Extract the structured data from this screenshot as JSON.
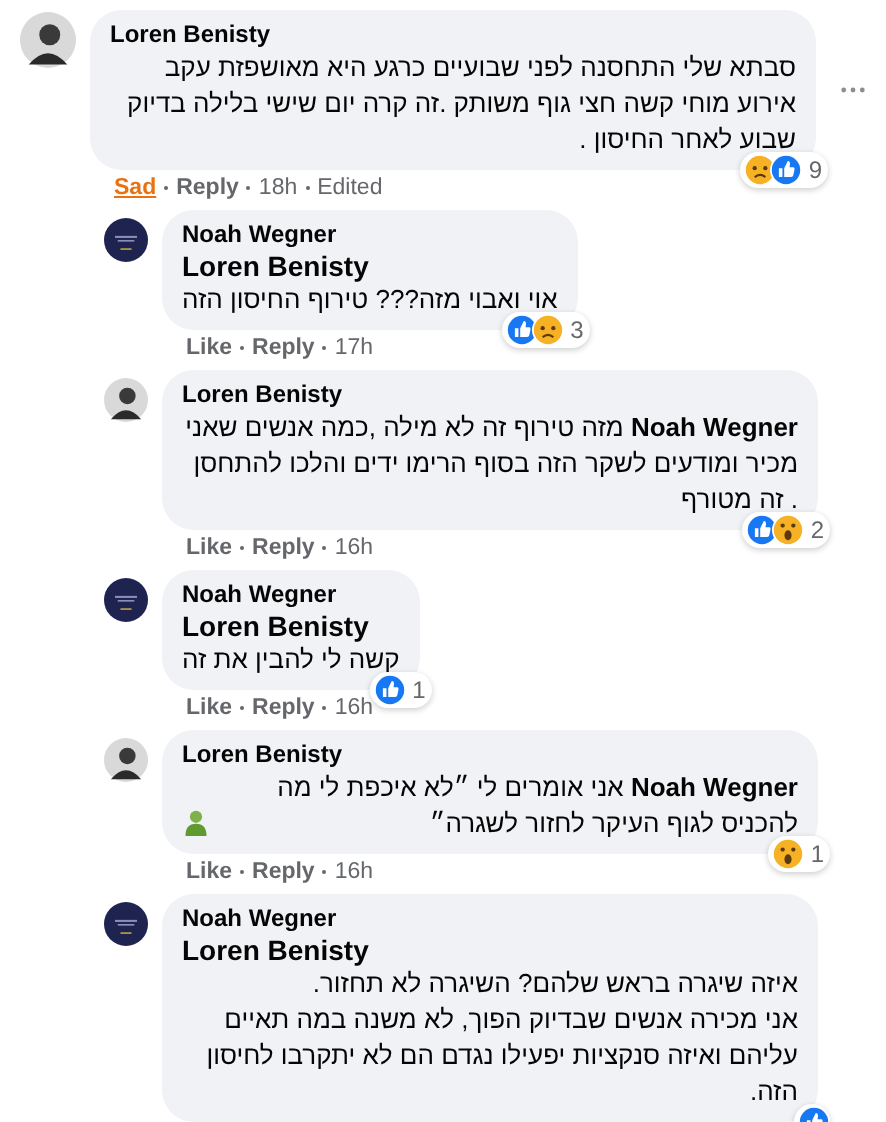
{
  "comments": [
    {
      "kind": "comment",
      "author": "Loren Benisty",
      "avatar": {
        "kind": "portrait"
      },
      "body": "סבתא שלי התחסנה לפני שבועיים כרגע היא מאושפזת עקב אירוע מוחי קשה חצי גוף משותק .זה קרה יום שישי בלילה בדיוק שבוע לאחר החיסון .",
      "reactions": [
        {
          "kind": "sad"
        },
        {
          "kind": "like"
        }
      ],
      "reaction_count": "9",
      "action_label": "Sad",
      "reacted": true,
      "reply_label": "Reply",
      "time": "18h",
      "edited": "Edited"
    },
    {
      "kind": "reply",
      "author": "Noah Wegner",
      "avatar": {
        "kind": "badge"
      },
      "mention": "Loren Benisty",
      "body": "אוי ואבוי מזה??? טירוף החיסון הזה",
      "reactions": [
        {
          "kind": "like"
        },
        {
          "kind": "sad"
        }
      ],
      "reaction_count": "3",
      "action_label": "Like",
      "reacted": false,
      "reply_label": "Reply",
      "time": "17h"
    },
    {
      "kind": "reply",
      "author": "Loren Benisty",
      "avatar": {
        "kind": "portrait"
      },
      "body": "**Noah Wegner** מזה טירוף זה לא מילה ,כמה אנשים שאני מכיר ומודעים לשקר הזה בסוף הרימו ידים והלכו להתחסן . זה מטורף",
      "reactions": [
        {
          "kind": "like"
        },
        {
          "kind": "wow"
        }
      ],
      "reaction_count": "2",
      "action_label": "Like",
      "reacted": false,
      "reply_label": "Reply",
      "time": "16h"
    },
    {
      "kind": "reply",
      "author": "Noah Wegner",
      "avatar": {
        "kind": "badge"
      },
      "mention": "Loren Benisty",
      "body": "קשה לי להבין את זה",
      "reactions": [
        {
          "kind": "like"
        }
      ],
      "reaction_count": "1",
      "action_label": "Like",
      "reacted": false,
      "reply_label": "Reply",
      "time": "16h"
    },
    {
      "kind": "reply",
      "author": "Loren Benisty",
      "avatar": {
        "kind": "portrait"
      },
      "body": "**Noah Wegner** אני אומרים לי ״לא איכפת לי מה להכניס לגוף העיקר לחזור לשגרה״",
      "emoji": {
        "kind": "person"
      },
      "reactions": [
        {
          "kind": "wow"
        }
      ],
      "reaction_count": "1",
      "action_label": "Like",
      "reacted": false,
      "reply_label": "Reply",
      "time": "16h"
    },
    {
      "kind": "reply",
      "author": "Noah Wegner",
      "avatar": {
        "kind": "badge"
      },
      "mention": "Loren Benisty",
      "body": "איזה שיגרה בראש שלהם? השיגרה לא תחזור.\nאני מכירה אנשים שבדיוק הפוך, לא משנה במה תאיים עליהם ואיזה סנקציות יפעילו נגדם הם לא יתקרבו לחיסון הזה.",
      "reactions": [
        {
          "kind": "like"
        }
      ]
    }
  ]
}
